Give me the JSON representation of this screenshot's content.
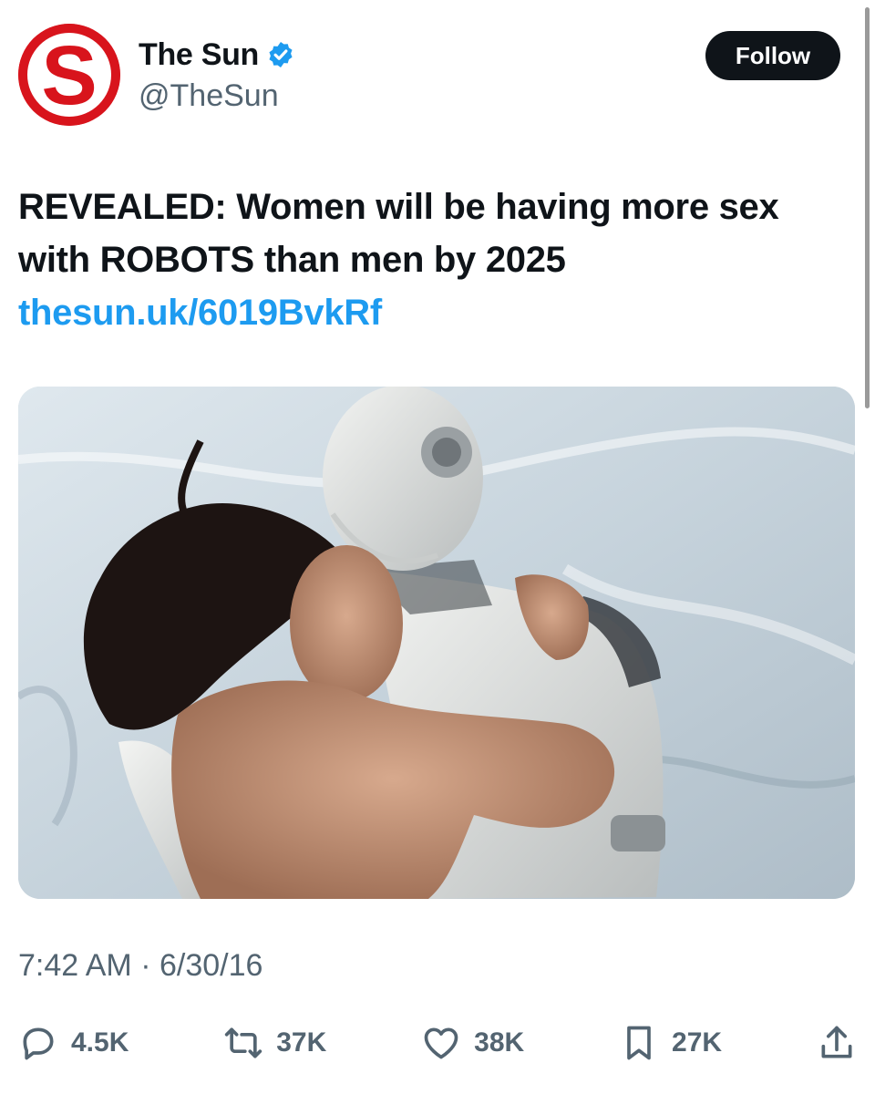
{
  "account": {
    "display_name": "The Sun",
    "handle": "@TheSun",
    "avatar_letter": "S",
    "verified": true
  },
  "follow_label": "Follow",
  "tweet": {
    "text": "REVEALED: Women will be having more sex with ROBOTS than men by 2025 ",
    "link_text": "thesun.uk/6019BvkRf"
  },
  "timestamp": "7:42 AM · 6/30/16",
  "actions": {
    "replies": "4.5K",
    "reposts": "37K",
    "likes": "38K",
    "bookmarks": "27K"
  },
  "icons": {
    "reply": "reply-icon",
    "repost": "repost-icon",
    "like": "like-icon",
    "bookmark": "bookmark-icon",
    "share": "share-icon",
    "verified": "verified-badge-icon"
  },
  "colors": {
    "brand_red": "#d8141c",
    "link_blue": "#1d9bf0",
    "verified_blue": "#1d9bf0",
    "text_primary": "#0f1419",
    "text_secondary": "#536471"
  }
}
